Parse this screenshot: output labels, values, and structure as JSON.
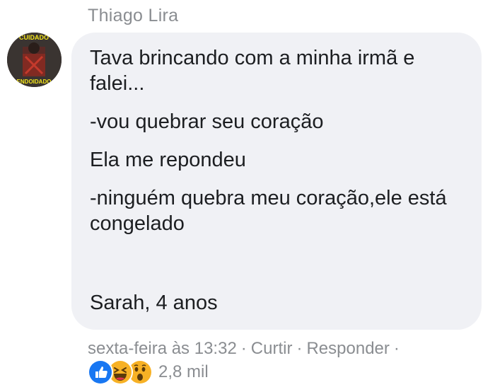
{
  "comment": {
    "author": "Thiago Lira",
    "avatar_icon": "user-avatar",
    "avatar_text_top": "CUIDADO",
    "avatar_text_bottom": "ENDOIDADO",
    "lines": [
      "Tava brincando com a minha irmã e falei...",
      "-vou quebrar seu coração",
      "Ela me repondeu",
      "-ninguém quebra meu coração,ele está congelado"
    ],
    "signature": "Sarah, 4 anos",
    "bubble_color": "#f0f1f5"
  },
  "meta": {
    "timestamp": "sexta-feira às 13:32",
    "separator": "·",
    "like_label": "Curtir",
    "reply_label": "Responder"
  },
  "reactions": {
    "icons": [
      "like-icon",
      "haha-icon",
      "wow-icon"
    ],
    "count": "2,8 mil",
    "like_color": "#1877f2",
    "emoji_color": "#f7b125"
  }
}
